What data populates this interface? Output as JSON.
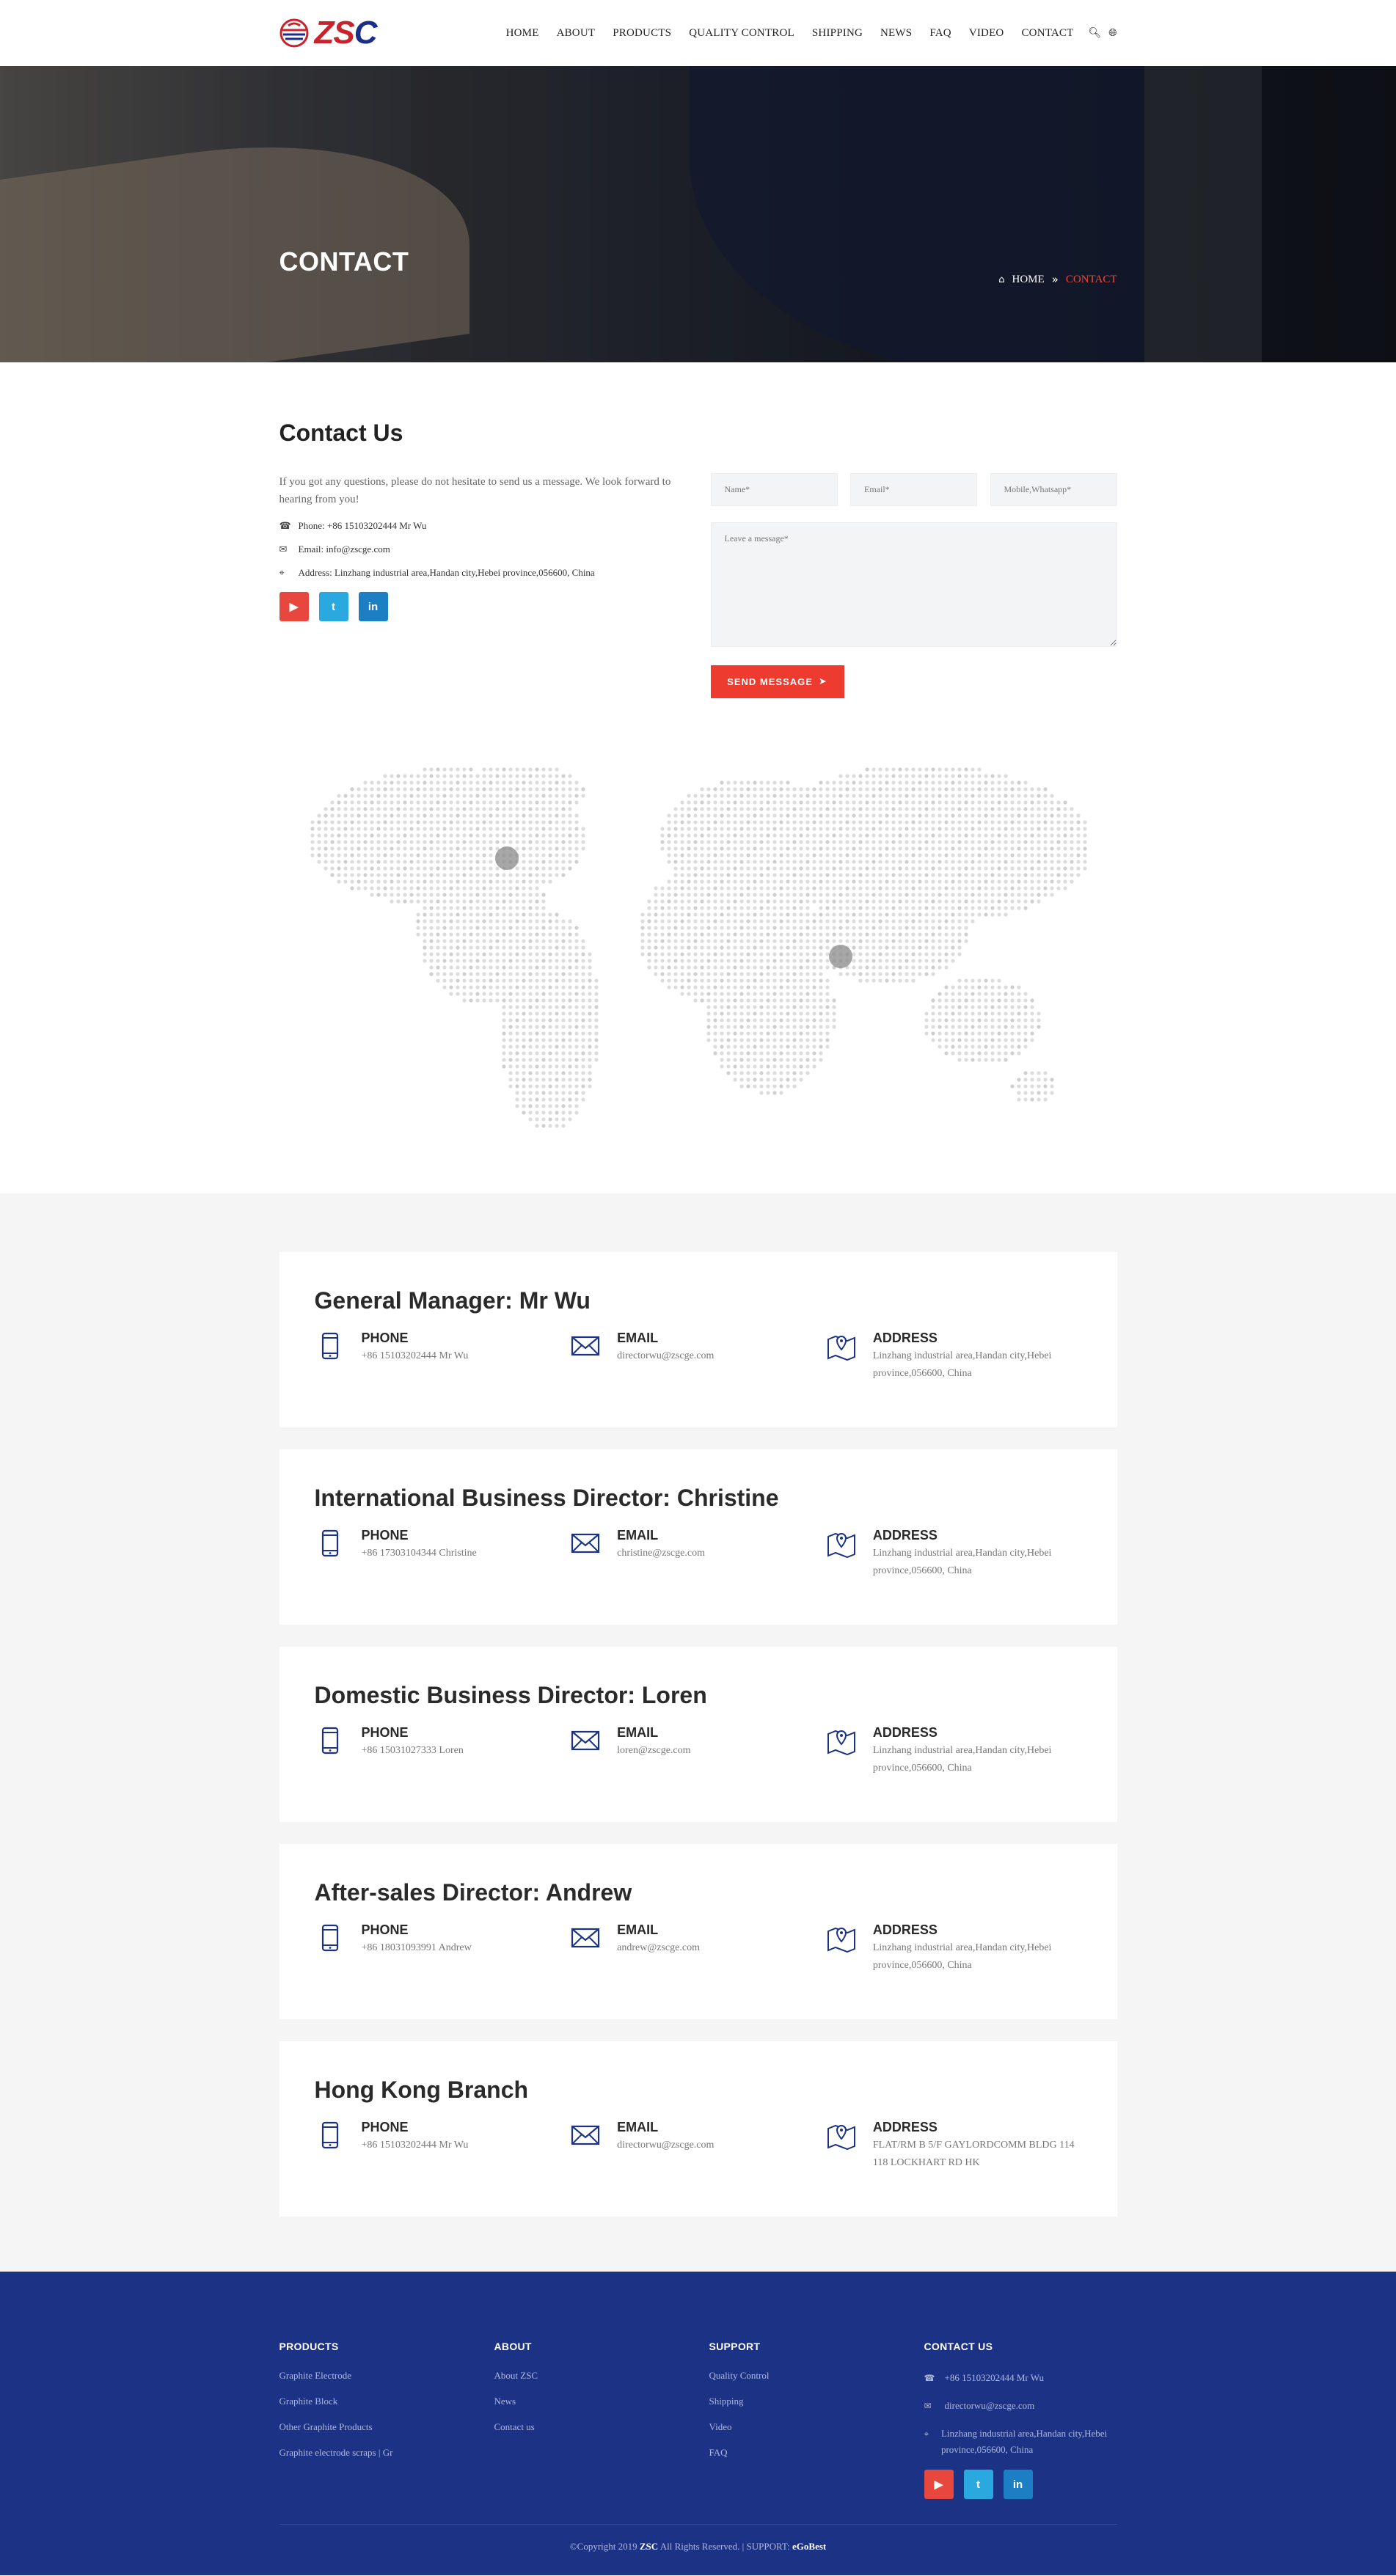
{
  "logo": {
    "text_red": "ZS",
    "text_blue": "C"
  },
  "nav": {
    "items": [
      "HOME",
      "ABOUT",
      "PRODUCTS",
      "QUALITY CONTROL",
      "SHIPPING",
      "NEWS",
      "FAQ",
      "VIDEO",
      "CONTACT"
    ],
    "icons": [
      "search-icon",
      "globe-icon"
    ]
  },
  "banner": {
    "title": "CONTACT",
    "breadcrumb": {
      "home": "HOME",
      "current": "CONTACT"
    }
  },
  "contact": {
    "heading": "Contact Us",
    "intro": "If you got any questions, please do not hesitate to send us a message. We look forward to hearing from you!",
    "phone": "Phone: +86 15103202444 Mr Wu",
    "email": "Email: info@zscge.com",
    "address": "Address: Linzhang industrial area,Handan city,Hebei province,056600,  China",
    "form": {
      "name_placeholder": "Name*",
      "email_placeholder": "Email*",
      "mobile_placeholder": "Mobile,Whatsapp*",
      "message_placeholder": "Leave a message*",
      "send_label": "SEND MESSAGE"
    }
  },
  "labels": {
    "phone": "PHONE",
    "email": "EMAIL",
    "address": "ADDRESS"
  },
  "team": [
    {
      "title": "General Manager:  Mr Wu",
      "phone": "+86 15103202444 Mr Wu",
      "email": "directorwu@zscge.com",
      "address": "Linzhang industrial area,Handan city,Hebei province,056600,  China"
    },
    {
      "title": "International Business Director:  Christine",
      "phone": "+86 17303104344 Christine",
      "email": "christine@zscge.com",
      "address": "Linzhang industrial area,Handan city,Hebei province,056600,  China"
    },
    {
      "title": "Domestic Business Director:  Loren",
      "phone": "+86 15031027333 Loren",
      "email": "loren@zscge.com",
      "address": "Linzhang industrial area,Handan city,Hebei province,056600,  China"
    },
    {
      "title": "After-sales Director:  Andrew",
      "phone": "+86 18031093991 Andrew",
      "email": "andrew@zscge.com",
      "address": "Linzhang industrial area,Handan city,Hebei province,056600,  China"
    },
    {
      "title": "Hong Kong Branch",
      "phone": "+86 15103202444 Mr Wu",
      "email": "directorwu@zscge.com",
      "address": "FLAT/RM B 5/F GAYLORDCOMM BLDG 114 118 LOCKHART RD HK"
    }
  ],
  "footer": {
    "products": {
      "heading": "PRODUCTS",
      "links": [
        "Graphite Electrode",
        "Graphite Block",
        "Other Graphite Products",
        "Graphite electrode scraps | Gr"
      ]
    },
    "about": {
      "heading": "ABOUT",
      "links": [
        "About ZSC",
        "News",
        "Contact us"
      ]
    },
    "support": {
      "heading": "SUPPORT",
      "links": [
        "Quality Control",
        "Shipping",
        "Video",
        "FAQ"
      ]
    },
    "contact": {
      "heading": "CONTACT US",
      "phone": "+86 15103202444 Mr Wu",
      "email": "directorwu@zscge.com",
      "address": "Linzhang industrial area,Handan city,Hebei province,056600,  China"
    },
    "copyright_pre": "©Copyright 2019 ",
    "copyright_brand": "ZSC",
    "copyright_mid": " All Rights Reserved.  |  SUPPORT: ",
    "copyright_support": "eGoBest"
  },
  "colors": {
    "brand_blue": "#1c3385",
    "accent_red": "#ee3b30",
    "icon_blue": "#1c3385"
  }
}
